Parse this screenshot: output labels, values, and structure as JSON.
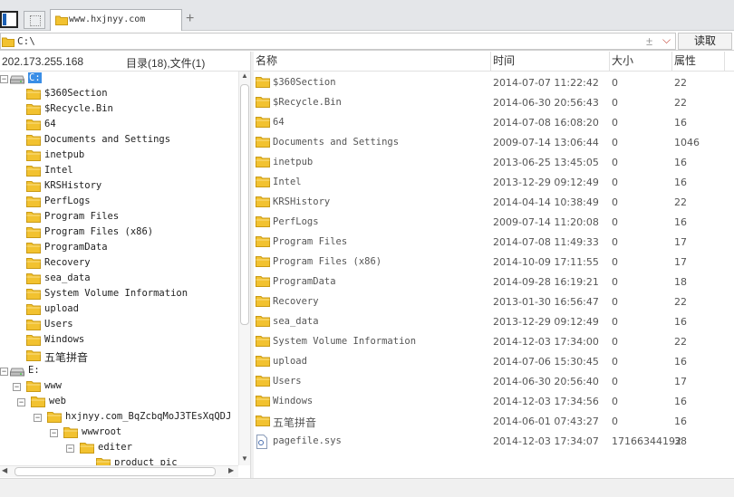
{
  "tabs": [
    {
      "label": "www.hxjnyy.com"
    }
  ],
  "address": {
    "path": "C:\\",
    "read_label": "读取",
    "star": "±",
    "dropdown": "⌵"
  },
  "server": {
    "ip": "202.173.255.168",
    "summary": "目录(18),文件(1)"
  },
  "tree": [
    {
      "label": "C:",
      "level": 0,
      "type": "drive",
      "expand": "-",
      "selected": true
    },
    {
      "label": "$360Section",
      "level": 1,
      "type": "folder"
    },
    {
      "label": "$Recycle.Bin",
      "level": 1,
      "type": "folder"
    },
    {
      "label": "64",
      "level": 1,
      "type": "folder"
    },
    {
      "label": "Documents and Settings",
      "level": 1,
      "type": "folder"
    },
    {
      "label": "inetpub",
      "level": 1,
      "type": "folder"
    },
    {
      "label": "Intel",
      "level": 1,
      "type": "folder"
    },
    {
      "label": "KRSHistory",
      "level": 1,
      "type": "folder"
    },
    {
      "label": "PerfLogs",
      "level": 1,
      "type": "folder"
    },
    {
      "label": "Program Files",
      "level": 1,
      "type": "folder"
    },
    {
      "label": "Program Files (x86)",
      "level": 1,
      "type": "folder"
    },
    {
      "label": "ProgramData",
      "level": 1,
      "type": "folder"
    },
    {
      "label": "Recovery",
      "level": 1,
      "type": "folder"
    },
    {
      "label": "sea_data",
      "level": 1,
      "type": "folder"
    },
    {
      "label": "System Volume Information",
      "level": 1,
      "type": "folder"
    },
    {
      "label": "upload",
      "level": 1,
      "type": "folder"
    },
    {
      "label": "Users",
      "level": 1,
      "type": "folder"
    },
    {
      "label": "Windows",
      "level": 1,
      "type": "folder"
    },
    {
      "label": "五笔拼音",
      "level": 1,
      "type": "folder",
      "cjk": true
    },
    {
      "label": "E:",
      "level": 0,
      "type": "drive",
      "expand": "-"
    },
    {
      "label": "www",
      "level": 1,
      "type": "folder",
      "expand": "-"
    },
    {
      "label": "web",
      "level": 2,
      "type": "folder",
      "expand": "-"
    },
    {
      "label": "hxjnyy.com_BqZcbqMoJ3TEsXqQDJ",
      "level": 3,
      "type": "folder",
      "expand": "-"
    },
    {
      "label": "wwwroot",
      "level": 4,
      "type": "folder",
      "expand": "-"
    },
    {
      "label": "editer",
      "level": 5,
      "type": "folder",
      "expand": "-"
    },
    {
      "label": "product_pic",
      "level": 6,
      "type": "folder"
    }
  ],
  "columns": {
    "name": "名称",
    "time": "时间",
    "size": "大小",
    "attr": "属性"
  },
  "files": [
    {
      "name": "$360Section",
      "time": "2014-07-07 11:22:42",
      "size": "0",
      "attr": "22",
      "type": "folder"
    },
    {
      "name": "$Recycle.Bin",
      "time": "2014-06-30 20:56:43",
      "size": "0",
      "attr": "22",
      "type": "folder"
    },
    {
      "name": "64",
      "time": "2014-07-08 16:08:20",
      "size": "0",
      "attr": "16",
      "type": "folder"
    },
    {
      "name": "Documents and Settings",
      "time": "2009-07-14 13:06:44",
      "size": "0",
      "attr": "1046",
      "type": "folder"
    },
    {
      "name": "inetpub",
      "time": "2013-06-25 13:45:05",
      "size": "0",
      "attr": "16",
      "type": "folder"
    },
    {
      "name": "Intel",
      "time": "2013-12-29 09:12:49",
      "size": "0",
      "attr": "16",
      "type": "folder"
    },
    {
      "name": "KRSHistory",
      "time": "2014-04-14 10:38:49",
      "size": "0",
      "attr": "22",
      "type": "folder"
    },
    {
      "name": "PerfLogs",
      "time": "2009-07-14 11:20:08",
      "size": "0",
      "attr": "16",
      "type": "folder"
    },
    {
      "name": "Program Files",
      "time": "2014-07-08 11:49:33",
      "size": "0",
      "attr": "17",
      "type": "folder"
    },
    {
      "name": "Program Files (x86)",
      "time": "2014-10-09 17:11:55",
      "size": "0",
      "attr": "17",
      "type": "folder"
    },
    {
      "name": "ProgramData",
      "time": "2014-09-28 16:19:21",
      "size": "0",
      "attr": "18",
      "type": "folder"
    },
    {
      "name": "Recovery",
      "time": "2013-01-30 16:56:47",
      "size": "0",
      "attr": "22",
      "type": "folder"
    },
    {
      "name": "sea_data",
      "time": "2013-12-29 09:12:49",
      "size": "0",
      "attr": "16",
      "type": "folder"
    },
    {
      "name": "System Volume Information",
      "time": "2014-12-03 17:34:00",
      "size": "0",
      "attr": "22",
      "type": "folder"
    },
    {
      "name": "upload",
      "time": "2014-07-06 15:30:45",
      "size": "0",
      "attr": "16",
      "type": "folder"
    },
    {
      "name": "Users",
      "time": "2014-06-30 20:56:40",
      "size": "0",
      "attr": "17",
      "type": "folder"
    },
    {
      "name": "Windows",
      "time": "2014-12-03 17:34:56",
      "size": "0",
      "attr": "16",
      "type": "folder"
    },
    {
      "name": "五笔拼音",
      "time": "2014-06-01 07:43:27",
      "size": "0",
      "attr": "16",
      "type": "folder",
      "cjk": true
    },
    {
      "name": "pagefile.sys",
      "time": "2014-12-03 17:34:07",
      "size": "17166344192",
      "attr": "38",
      "type": "file"
    }
  ],
  "colors": {
    "folder": "#f2c230",
    "folder_edge": "#c99a14",
    "selection": "#3a8ee6",
    "accent": "#1a5fb4"
  }
}
